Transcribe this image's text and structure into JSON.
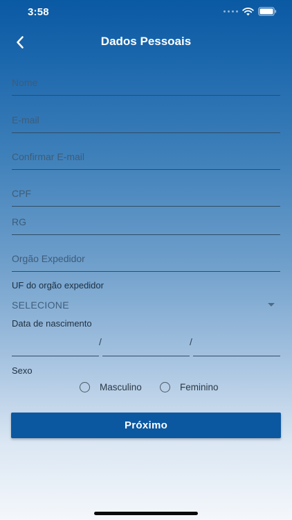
{
  "status_bar": {
    "time": "3:58"
  },
  "header": {
    "title": "Dados Pessoais",
    "back_icon": "chevron-left-icon"
  },
  "form": {
    "nome_placeholder": "Nome",
    "email_placeholder": "E-mail",
    "confirm_email_placeholder": "Confirmar E-mail",
    "cpf_placeholder": "CPF",
    "rg_placeholder": "RG",
    "orgao_placeholder": "Orgão Expedidor",
    "uf_label": "UF do orgão expedidor",
    "uf_selected": "SELECIONE",
    "birthdate_label": "Data de nascimento",
    "date_separator": "/",
    "sexo_label": "Sexo",
    "sexo_options": [
      "Masculino",
      "Feminino"
    ]
  },
  "actions": {
    "next_label": "Próximo"
  },
  "colors": {
    "primary": "#0b58a1",
    "field_line": "#2f4c66"
  }
}
